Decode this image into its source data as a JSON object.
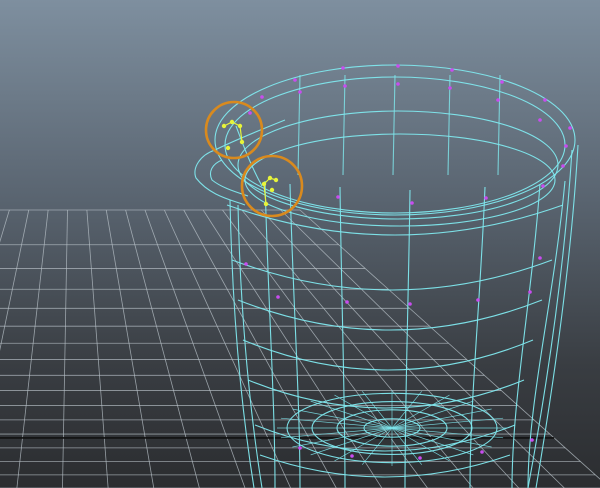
{
  "viewport": {
    "type": "3d-perspective-viewport",
    "object": "cup-with-spout-wireframe",
    "colors": {
      "background_top": "#7e8f9f",
      "background_bottom": "#2b2d30",
      "grid": "#b9c3c9",
      "grid_axis": "#111111",
      "wireframe": "#7fe8ee",
      "vertex": "#c84cf0",
      "selected_vertex": "#e7f43a",
      "highlight_ring": "#d98a1e"
    },
    "highlights": [
      {
        "name": "spout-top-vertices",
        "selected": true
      },
      {
        "name": "spout-lower-vertices",
        "selected": true
      }
    ]
  }
}
